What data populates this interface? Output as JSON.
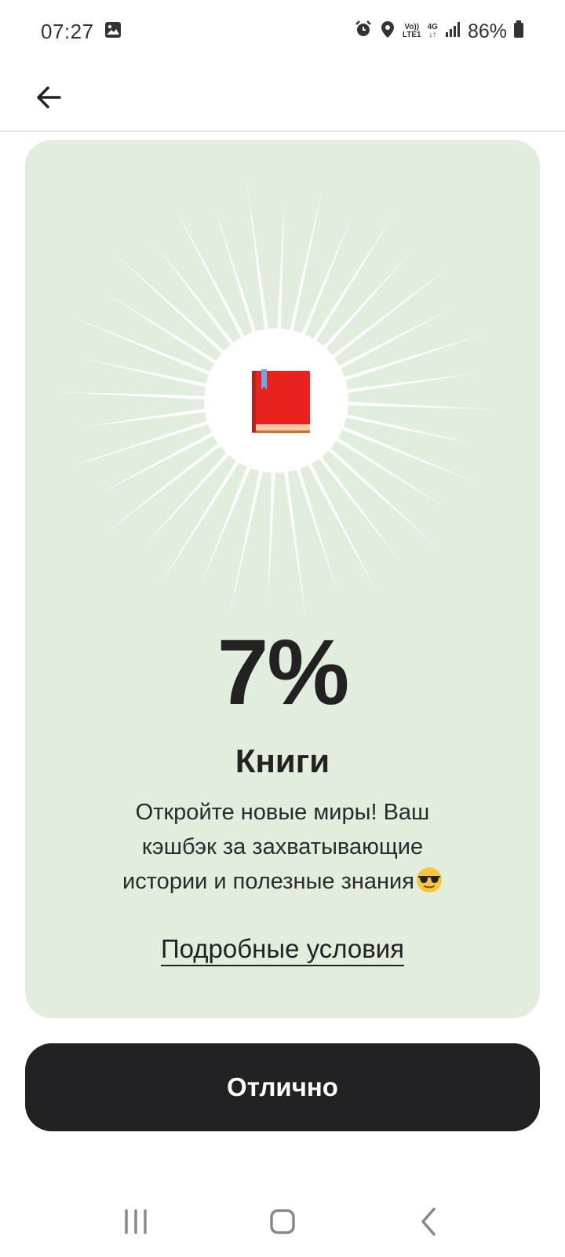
{
  "status_bar": {
    "time": "07:27",
    "volte_label": "Vo))",
    "lte_label": "LTE1",
    "network_label": "4G",
    "battery": "86%",
    "icons": [
      "image-icon",
      "alarm-icon",
      "location-icon",
      "volte-icon",
      "data-arrows-icon",
      "signal-icon",
      "battery-icon"
    ]
  },
  "header": {
    "back_icon": "arrow-left-icon"
  },
  "card": {
    "background_color": "#e1eedd",
    "illustration_icon": "red-book-icon",
    "percent": "7%",
    "category": "Книги",
    "description_line1": "Откройте новые миры! Ваш",
    "description_line2": "кэшбэк за захватывающие",
    "description_line3": "истории и полезные знания",
    "description_emoji": "sunglasses-emoji-icon",
    "terms_link": "Подробные условия"
  },
  "primary_button": {
    "label": "Отлично",
    "color": "#222224"
  },
  "nav_bar": {
    "icons": [
      "recents-icon",
      "home-icon",
      "back-icon"
    ]
  }
}
